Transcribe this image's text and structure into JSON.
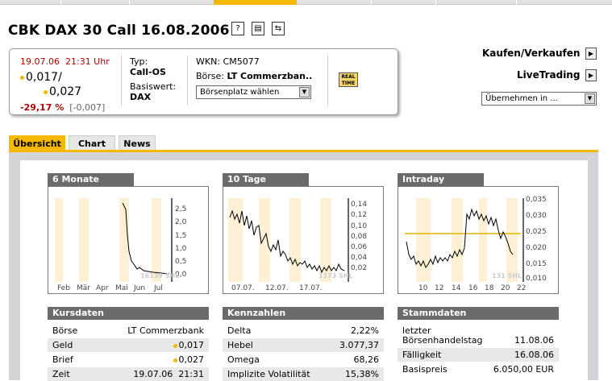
{
  "title": "CBK DAX 30 Call 16.08.2006",
  "title_icons": [
    "help-icon",
    "print-icon",
    "refresh-icon"
  ],
  "quote": {
    "date": "19.07.06",
    "time": "21:31 Uhr",
    "bid": "0,017/",
    "ask": "0,027",
    "change_pct": "-29,17 %",
    "change_abs": "[-0,007]",
    "typ_label": "Typ:",
    "typ_value": "Call-OS",
    "basis_label": "Basiswert:",
    "basis_value": "DAX",
    "wkn": "WKN: CM5077",
    "boerse_label": "Börse:",
    "boerse_value": "LT Commerzban..",
    "boersenplatz_select": "Börsenplatz wählen",
    "realtime_badge": "REAL TIME"
  },
  "right": {
    "kaufen": "Kaufen/Verkaufen",
    "livetrading": "LiveTrading",
    "uebernehmen_select": "Übernehmen in ..."
  },
  "tabs": [
    {
      "label": "Übersicht",
      "active": true
    },
    {
      "label": "Chart",
      "active": false
    },
    {
      "label": "News",
      "active": false
    }
  ],
  "charts": [
    {
      "title": "6 Monate",
      "x_labels": [
        "Feb",
        "Mär",
        "Apr",
        "Mai",
        "Jun",
        "Jul"
      ],
      "y_labels": [
        "2,5",
        "2,0",
        "1,5",
        "1,0",
        "0,5",
        "0,0"
      ],
      "watermark": "16139 SHL"
    },
    {
      "title": "10 Tage",
      "x_labels": [
        "07.07.",
        "12.07.",
        "17.07."
      ],
      "y_labels": [
        "0,14",
        "0,12",
        "0,10",
        "0,08",
        "0,06",
        "0,04",
        "0,02"
      ],
      "watermark": "1173 SHL"
    },
    {
      "title": "Intraday",
      "x_labels": [
        "10",
        "12",
        "14",
        "16",
        "18",
        "20",
        "22"
      ],
      "y_labels": [
        "0,035",
        "0,030",
        "0,025",
        "0,020",
        "0,015",
        "0,010"
      ],
      "watermark": "131 SHL"
    }
  ],
  "kursdaten": {
    "title": "Kursdaten",
    "rows": [
      {
        "k": "Börse",
        "v": "LT Commerzbank",
        "dot": false
      },
      {
        "k": "Geld",
        "v": "0,017",
        "dot": true
      },
      {
        "k": "Brief",
        "v": "0,027",
        "dot": true
      },
      {
        "k": "Zeit",
        "v": "19.07.06  21:31",
        "dot": false
      }
    ]
  },
  "kennzahlen": {
    "title": "Kennzahlen",
    "rows": [
      {
        "k": "Delta",
        "v": "2,22%"
      },
      {
        "k": "Hebel",
        "v": "3.077,37"
      },
      {
        "k": "Omega",
        "v": "68,26"
      },
      {
        "k": "Implizite Volatilität",
        "v": "15,38%"
      }
    ]
  },
  "stammdaten": {
    "title": "Stammdaten",
    "rows": [
      {
        "k": "letzter\nBörsenhandelstag",
        "v": "11.08.06"
      },
      {
        "k": "Fälligkeit",
        "v": "16.08.06"
      },
      {
        "k": "Basispreis",
        "v": "6.050,00 EUR"
      }
    ]
  }
}
